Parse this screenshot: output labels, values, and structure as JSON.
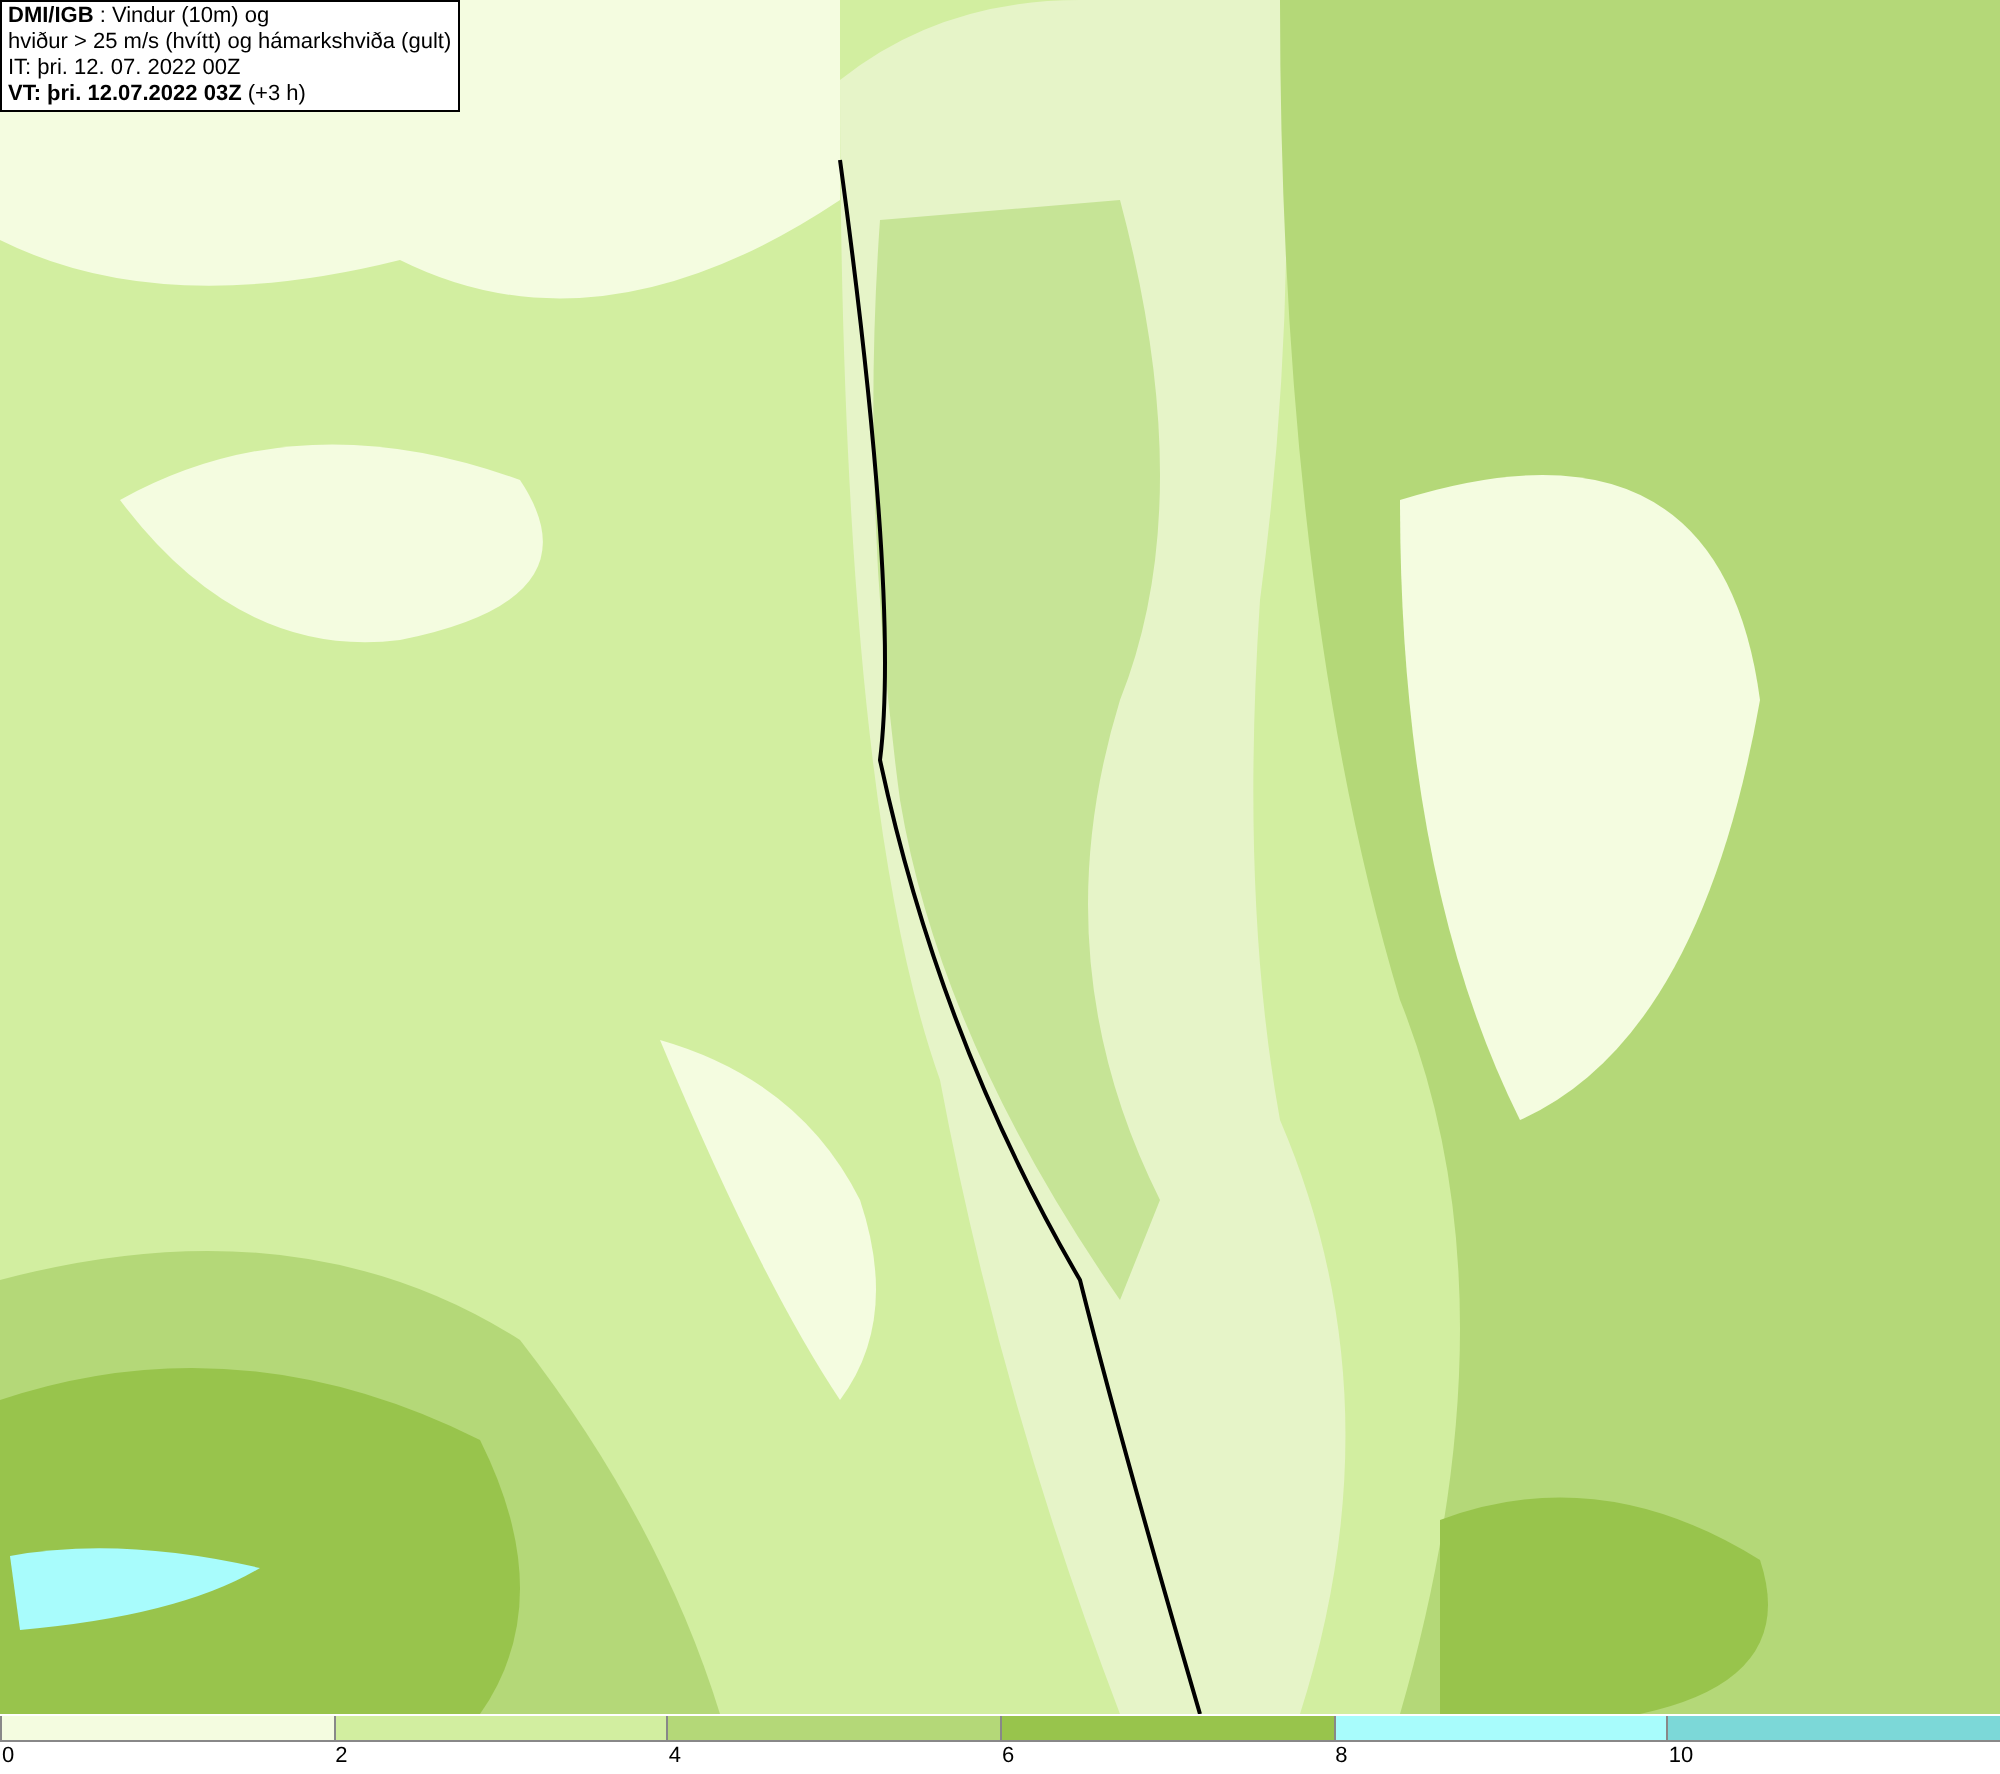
{
  "map": {
    "info_lines": [
      "**DMI/IGB** : Vindur (10m) og",
      "hviður > 25 m/s (hvítt) og hámarkshviða (gult)",
      "IT: þri. 12. 07. 2022 00Z",
      "**VT: þri. 12.07.2022 03Z** (+3 h)"
    ]
  },
  "legend": [
    {
      "label": "0",
      "color": "#f4fce0"
    },
    {
      "label": "2",
      "color": "#d2eea0"
    },
    {
      "label": "4",
      "color": "#b4d878"
    },
    {
      "label": "6",
      "color": "#98c44c"
    },
    {
      "label": "8",
      "color": "#a8fcfc"
    },
    {
      "label": "10",
      "color": "#7cd8d8"
    }
  ]
}
